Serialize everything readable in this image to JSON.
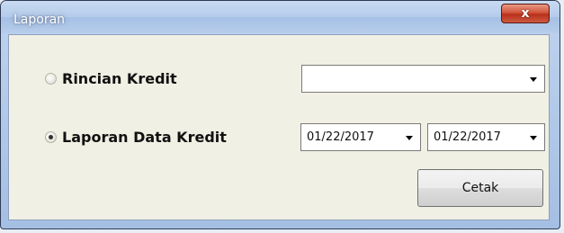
{
  "window": {
    "title": "Laporan",
    "close_glyph": "x"
  },
  "options": [
    {
      "label": "Rincian Kredit",
      "checked": false
    },
    {
      "label": "Laporan Data Kredit",
      "checked": true
    }
  ],
  "rincian_combo": {
    "value": ""
  },
  "date_from": {
    "value": "01/22/2017"
  },
  "date_to": {
    "value": "01/22/2017"
  },
  "actions": {
    "print_label": "Cetak"
  },
  "colors": {
    "titlebar": "#b4cbea",
    "client_bg": "#f1f0e4",
    "close_button": "#c8432a"
  },
  "icons": {
    "close": "close-icon",
    "dropdown": "chevron-down-icon"
  }
}
